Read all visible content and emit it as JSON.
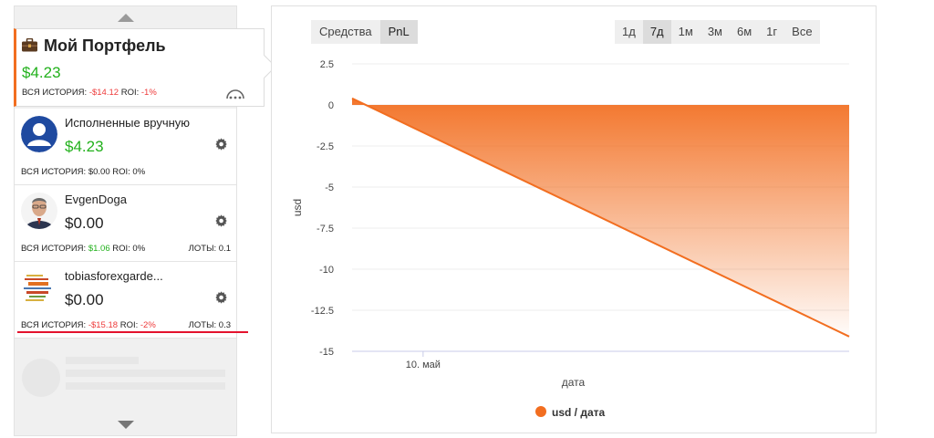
{
  "sidebar": {
    "portfolio": {
      "title": "Мой Портфель",
      "balance": "$4.23",
      "history_label": "ВСЯ ИСТОРИЯ:",
      "history_value": "-$14.12",
      "roi_label": "ROI:",
      "roi_value": "-1%"
    },
    "accounts": [
      {
        "name": "Исполненные вручную",
        "balance": "$4.23",
        "history_label": "ВСЯ ИСТОРИЯ:",
        "history_value": "$0.00",
        "roi_label": "ROI:",
        "roi_value": "0%",
        "lots": ""
      },
      {
        "name": "EvgenDoga",
        "balance": "$0.00",
        "history_label": "ВСЯ ИСТОРИЯ:",
        "history_value": "$1.06",
        "roi_label": "ROI:",
        "roi_value": "0%",
        "lots": "ЛОТЫ: 0.1"
      },
      {
        "name": "tobiasforexgarde...",
        "balance": "$0.00",
        "history_label": "ВСЯ ИСТОРИЯ:",
        "history_value": "-$15.18",
        "roi_label": "ROI:",
        "roi_value": "-2%",
        "lots": "ЛОТЫ: 0.3"
      }
    ]
  },
  "chart_tabs": {
    "metric": [
      "Средства",
      "PnL"
    ],
    "metric_active": "PnL",
    "period": [
      "1д",
      "7д",
      "1м",
      "3м",
      "6м",
      "1г",
      "Все"
    ],
    "period_active": "7д"
  },
  "colors": {
    "accent": "#f26e20",
    "positive": "#22b11c",
    "negative": "#ee3a3a",
    "underline": "#e4132e"
  },
  "chart_data": {
    "type": "area",
    "title": "",
    "xlabel": "дата",
    "ylabel": "usd",
    "ylim": [
      -15,
      2.5
    ],
    "yticks": [
      2.5,
      0,
      -2.5,
      -5,
      -7.5,
      -10,
      -12.5,
      -15
    ],
    "xlim": [
      0,
      7
    ],
    "xticks": [
      {
        "x": 1,
        "label": "10. май"
      }
    ],
    "grid": true,
    "legend": "bottom",
    "series": [
      {
        "name": "usd / дата",
        "color": "#f26e20",
        "fill_to": 0,
        "points": [
          [
            0,
            0.4
          ],
          [
            7,
            -14.1
          ]
        ]
      }
    ]
  }
}
